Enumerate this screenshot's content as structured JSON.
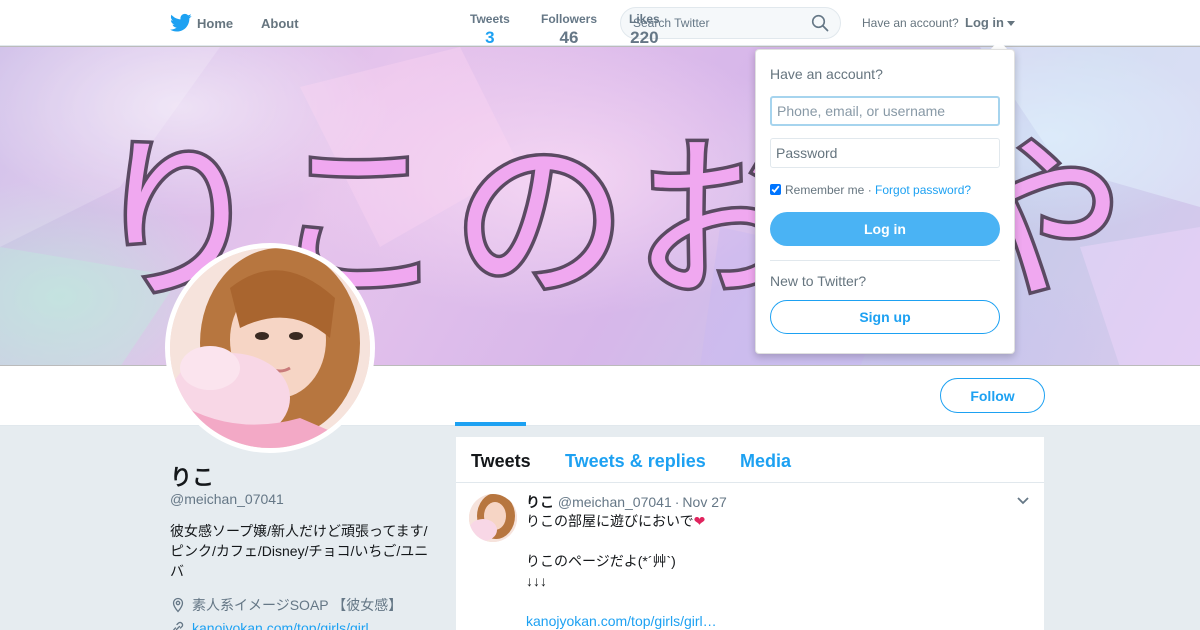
{
  "nav": {
    "home_label": "Home",
    "about_label": "About",
    "search_placeholder": "Search Twitter",
    "have_account": "Have an account?",
    "login_label": "Log in",
    "brand_icon": "twitter-bird-icon"
  },
  "banner": {
    "text_visible": "りこのお",
    "text_trailing": "や"
  },
  "profile": {
    "name": "りこ",
    "handle": "@meichan_07041",
    "bio": "彼女感ソープ嬢/新人だけど頑張ってます/ピンク/カフェ/Disney/チョコ/いちご/ユニバ",
    "location": "素人系イメージSOAP 【彼女感】",
    "link": "kanojyokan.com/top/girls/girl..."
  },
  "stats": [
    {
      "label": "Tweets",
      "value": "3",
      "active": true
    },
    {
      "label": "Followers",
      "value": "46",
      "active": false
    },
    {
      "label": "Likes",
      "value": "220",
      "active": false
    }
  ],
  "follow_label": "Follow",
  "timeline": {
    "tabs": [
      "Tweets",
      "Tweets & replies",
      "Media"
    ],
    "tweet": {
      "name": "りこ",
      "handle": "@meichan_07041",
      "dot": "·",
      "date": "Nov 27",
      "line1": "りこの部屋に遊びにおいで",
      "heart": "❤",
      "line2": "",
      "line3": "りこのページだよ(*´艸`)",
      "line4": "↓↓↓",
      "line5": "",
      "link": "kanojyokan.com/top/girls/girl…"
    }
  },
  "login_dropdown": {
    "title": "Have an account?",
    "username_placeholder": "Phone, email, or username",
    "password_placeholder": "Password",
    "remember_label": "Remember me",
    "separator": " · ",
    "forgot_label": "Forgot password?",
    "login_button": "Log in",
    "new_label": "New to Twitter?",
    "signup_button": "Sign up"
  },
  "colors": {
    "accent": "#1da1f2",
    "login_button": "#4ab3f4",
    "banner_text": "#f0a8f0"
  }
}
